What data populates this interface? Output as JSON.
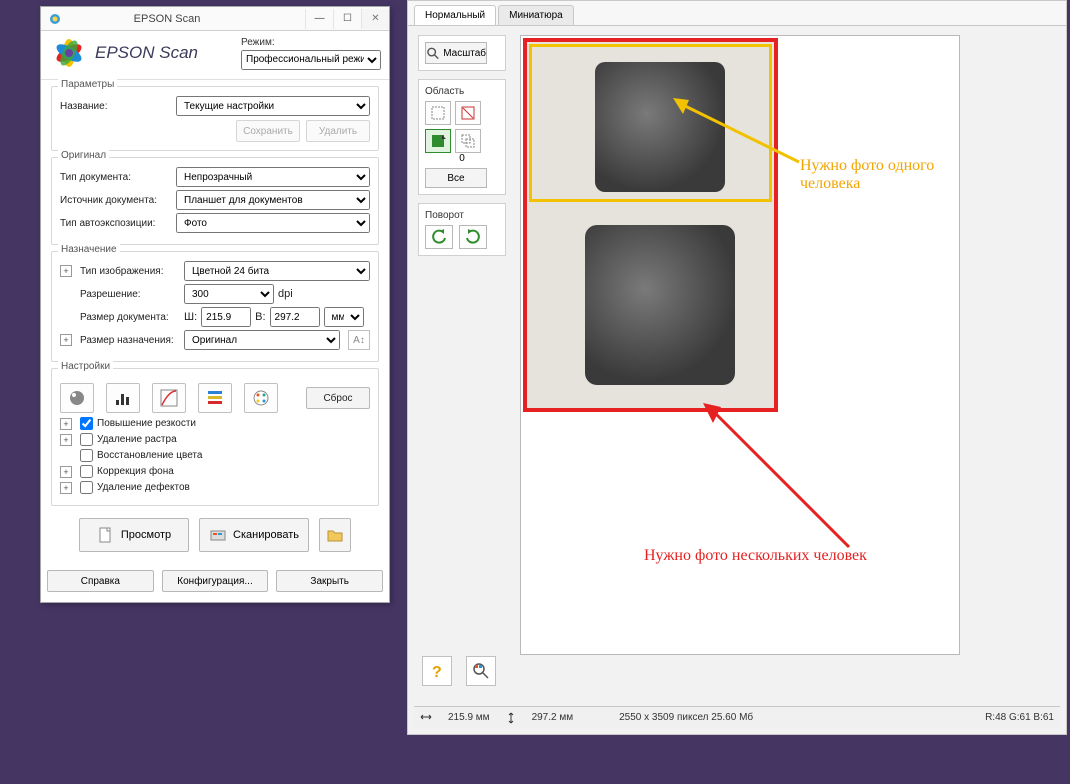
{
  "window": {
    "title": "EPSON Scan",
    "brand": "EPSON Scan",
    "mode_label": "Режим:",
    "mode_value": "Профессиональный режим"
  },
  "params": {
    "legend": "Параметры",
    "name_label": "Название:",
    "name_value": "Текущие настройки",
    "save_btn": "Сохранить",
    "delete_btn": "Удалить"
  },
  "original": {
    "legend": "Оригинал",
    "doc_type_label": "Тип документа:",
    "doc_type_value": "Непрозрачный",
    "source_label": "Источник документа:",
    "source_value": "Планшет для документов",
    "autoexp_label": "Тип автоэкспозиции:",
    "autoexp_value": "Фото"
  },
  "destination": {
    "legend": "Назначение",
    "imgtype_label": "Тип изображения:",
    "imgtype_value": "Цветной 24 бита",
    "res_label": "Разрешение:",
    "res_value": "300",
    "res_unit": "dpi",
    "docsize_label": "Размер документа:",
    "w_label": "Ш:",
    "w_value": "215.9",
    "h_label": "В:",
    "h_value": "297.2",
    "units_value": "мм",
    "destsize_label": "Размер назначения:",
    "destsize_value": "Оригинал"
  },
  "adjust": {
    "legend": "Настройки",
    "reset_btn": "Сброс",
    "sharpen": "Повышение резкости",
    "descreen": "Удаление растра",
    "color_restore": "Восстановление цвета",
    "backlight": "Коррекция фона",
    "dust": "Удаление дефектов"
  },
  "footer": {
    "preview_btn": "Просмотр",
    "scan_btn": "Сканировать",
    "help_btn": "Справка",
    "config_btn": "Конфигурация...",
    "close_btn": "Закрыть"
  },
  "tabs": {
    "normal": "Нормальный",
    "thumb": "Миниатюра"
  },
  "tools": {
    "zoom_label": "Масштаб",
    "area_label": "Область",
    "area_count": "0",
    "all_btn": "Все",
    "rotate_label": "Поворот"
  },
  "annotations": {
    "yellow": "Нужно фото одного человека",
    "red": "Нужно фото нескольких человек"
  },
  "status": {
    "size_mm": "215.9 мм",
    "size_mm2": "297.2 мм",
    "pixels": "2550 x 3509 пиксел 25.60 Мб",
    "rgb": "R:48 G:61 B:61"
  }
}
